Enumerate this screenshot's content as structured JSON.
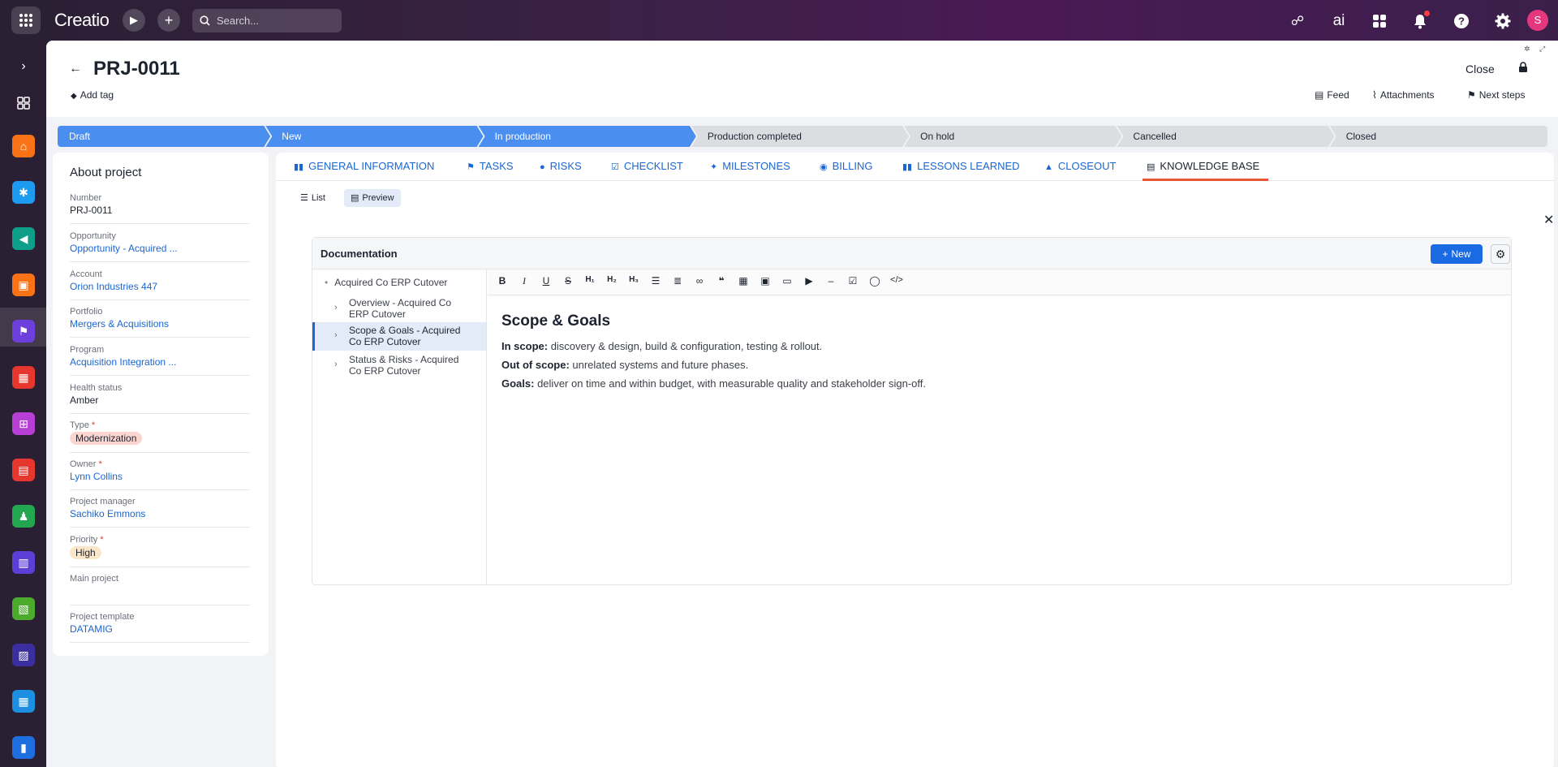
{
  "topbar": {
    "logo": "Creatio",
    "search_placeholder": "Search...",
    "ai_label": "ai",
    "avatar_initial": "S"
  },
  "header": {
    "title": "PRJ-0011",
    "add_tag": "Add tag",
    "close": "Close",
    "feed": "Feed",
    "attachments": "Attachments",
    "next_steps": "Next steps"
  },
  "stages": [
    {
      "label": "Draft",
      "done": true
    },
    {
      "label": "New",
      "done": true
    },
    {
      "label": "In production",
      "done": true
    },
    {
      "label": "Production completed",
      "done": false
    },
    {
      "label": "On hold",
      "done": false
    },
    {
      "label": "Cancelled",
      "done": false
    },
    {
      "label": "Closed",
      "done": false
    }
  ],
  "about": {
    "title": "About project",
    "fields": [
      {
        "label": "Number",
        "value": "PRJ-0011"
      },
      {
        "label": "Opportunity",
        "value": "Opportunity - Acquired ..."
      },
      {
        "label": "Account",
        "value": "Orion Industries 447"
      },
      {
        "label": "Portfolio",
        "value": "Mergers & Acquisitions"
      },
      {
        "label": "Program",
        "value": "Acquisition Integration ..."
      },
      {
        "label": "Health status",
        "value": "Amber"
      },
      {
        "label": "Type",
        "value": "Modernization"
      },
      {
        "label": "Owner",
        "value": "Lynn Collins"
      },
      {
        "label": "Project manager",
        "value": "Sachiko Emmons"
      },
      {
        "label": "Priority",
        "value": "High"
      },
      {
        "label": "Main project",
        "value": ""
      },
      {
        "label": "Project template",
        "value": "DATAMIG"
      }
    ],
    "colors": {
      "type_chip": "#fbd5d0",
      "priority_chip": "#fbe6c9"
    }
  },
  "tabs": [
    {
      "label": "General information",
      "icon": "book-icon"
    },
    {
      "label": "Tasks",
      "icon": "flag-icon"
    },
    {
      "label": "Risks",
      "icon": "alert-icon"
    },
    {
      "label": "Checklist",
      "icon": "checklist-icon"
    },
    {
      "label": "Milestones",
      "icon": "milestone-icon"
    },
    {
      "label": "Billing",
      "icon": "billing-icon"
    },
    {
      "label": "Lessons learned",
      "icon": "book-icon"
    },
    {
      "label": "Closeout",
      "icon": "lock-icon"
    },
    {
      "label": "Knowledge base",
      "icon": "document-icon"
    }
  ],
  "view_toggle": {
    "list": "List",
    "preview": "Preview"
  },
  "documentation": {
    "title": "Documentation",
    "new_button": "New",
    "tree": {
      "root": "Acquired Co ERP Cutover",
      "items": [
        {
          "line1": "Overview - Acquired Co",
          "line2": "ERP Cutover"
        },
        {
          "line1": "Scope & Goals - Acquired",
          "line2": "Co ERP Cutover"
        },
        {
          "line1": "Status & Risks - Acquired",
          "line2": "Co ERP Cutover"
        }
      ]
    },
    "article": {
      "heading": "Scope & Goals",
      "p1_label": "In scope:",
      "p1_text": " discovery & design, build & configuration, testing & rollout.",
      "p2_label": "Out of scope:",
      "p2_text": " unrelated systems and future phases.",
      "p3_label": "Goals:",
      "p3_text": " deliver on time and within budget, with measurable quality and stakeholder sign-off."
    }
  },
  "colors": {
    "accent": "#1a66d2",
    "stage_done": "#4a8ef0",
    "tab_underline": "#e8563a"
  }
}
